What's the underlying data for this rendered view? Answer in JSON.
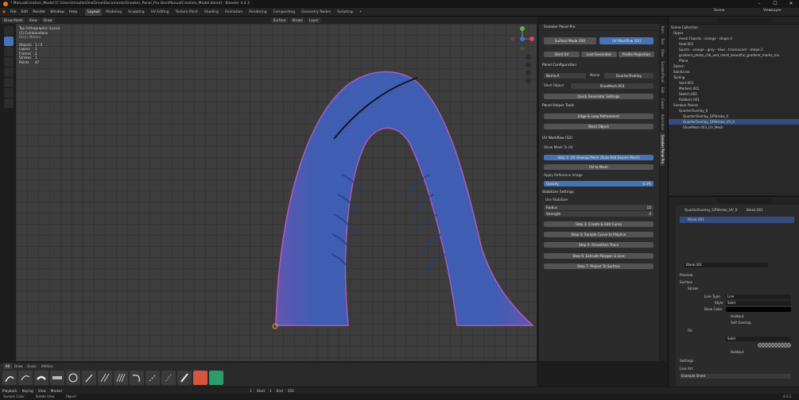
{
  "window": {
    "title": "* ManualCreation_Model [C:\\Users\\mouhk\\OneDrive\\Documents\\Sneaker_Panel_Pro Dev\\ManualCreation_Model.blend] - Blender 4.4.3",
    "min": "–",
    "max": "☐",
    "close": "✕"
  },
  "menu": [
    "File",
    "Edit",
    "Render",
    "Window",
    "Help"
  ],
  "workspaces": [
    "Layout",
    "Modeling",
    "Sculpting",
    "UV Editing",
    "Texture Paint",
    "Shading",
    "Animation",
    "Rendering",
    "Compositing",
    "Geometry Nodes",
    "Scripting",
    "+"
  ],
  "scene": {
    "label": "Scene",
    "viewlayer": "ViewLayer"
  },
  "viewport_header": {
    "mode": "Draw Mode",
    "view": "View",
    "draw": "Draw",
    "surface": "Surface",
    "layer": "Layer",
    "stroke": "Stroke"
  },
  "overlay": {
    "view_name": "Top Orthographic (Local)",
    "collection": "(1) Combinations",
    "sub": "Grid | Meters",
    "stats": [
      [
        "Objects",
        "1 / 5"
      ],
      [
        "Layers",
        "1"
      ],
      [
        "Frames",
        "2"
      ],
      [
        "Strokes",
        "1"
      ],
      [
        "Points",
        "47"
      ]
    ]
  },
  "npanel": {
    "title": "Sneaker Panel Pro",
    "surface_mode": "Surface Mode (S0)",
    "uv_workflow": "UV Workflow (S2)",
    "start_uv": "Start UV",
    "last_generator": "Last Generator",
    "profile_projection": "Profile Projection",
    "panel_config": "Panel Configuration",
    "field_a": "Name.A",
    "field_a_val": "4",
    "name_label": "Name",
    "name_val": "QuarterOverlay",
    "shell_obj_label": "Shell Object",
    "shell_obj": "ShoeMesh.003",
    "quick_generator": "Quick Generator Settings",
    "panel_helper": "Panel Helper Tools",
    "edge_loop": "Edge & Loop Refinement",
    "mesh_object": "Mesh Object",
    "uv_workflow_sec": "UV Workflow (S2)",
    "show_mesh": "Show Mesh To UV",
    "step1": "Step 1: UV Unwrap Mesh (Auto Add Seams Mesh)",
    "uv_mesh": "UV to Mesh",
    "apply_ref": "Apply Reference Image",
    "opacity": "Opacity",
    "opacity_val": "0.3%",
    "stab_settings": "Stabilizer Settings",
    "use_stab": "Use Stabilizer",
    "radius": "Radius",
    "radius_val": "15",
    "strength": "Strength",
    "strength_val": "0",
    "step3": "Step 3: Create & Edit Curve",
    "step4": "Step 4: Sample Curve to Polyline",
    "step5": "Step 5: Smoothen Trace",
    "step6": "Step 6: Extrude Polygon & Line",
    "step7": "Step 7: Project To Surface"
  },
  "vtabs": [
    "Item",
    "Tool",
    "View",
    "SneakerPanel",
    "Edit",
    "Create",
    "Animation",
    "Sneaker Panel Pro"
  ],
  "outliner": {
    "search": "",
    "items": [
      "Scene Collection",
      "Upper",
      "mesh.f.Sports - orange - shape.3",
      "Heel.001",
      "Sports - orange - gray - blue - translucent - shape.3",
      "gradient_photo_cilb_and_mesh_beautiful_gradient_marks_ma",
      "Plane",
      "Sketch",
      "SolidLines",
      "Tooling",
      "Vent.001",
      "Markers.001",
      "Sketch.002",
      "Rubbers.001",
      "Sneaker Panels",
      "QuarterOverlay_0",
      "QuarterOverlay_GPStroke_0",
      "QuarterOverlay_GPStroke_UV_0",
      "ShoeMesh.003_UV_Mesh"
    ]
  },
  "properties": {
    "object": "QuarterOverlay_GPStroke_UV_0",
    "data": "Blank.001",
    "material": "Blank.001",
    "material_field": "Blank.001",
    "preview": "Preview",
    "surface": "Surface",
    "stroke": "Stroke",
    "line_type_label": "Line Type",
    "line_type": "Line",
    "style_label": "Style",
    "style": "Solid",
    "base_color_label": "Base Color",
    "holdout": "Holdout",
    "self_overlap": "Self Overlap",
    "fill": "Fill",
    "fill_style": "Solid",
    "settings": "Settings",
    "viewport_display": "Viewport Display",
    "custom_props": "Custom Properties",
    "line_art": "Line Art",
    "example_sheet": "Example Sheet"
  },
  "shelf_tabs": [
    "All",
    "Draw",
    "Erase",
    "Utilities"
  ],
  "timeline": {
    "playback": "Playback",
    "keying": "Keying",
    "view": "View",
    "marker": "Marker",
    "start": "Start",
    "start_val": "1",
    "end": "End",
    "end_val": "250",
    "frame": "1"
  },
  "status": {
    "left": "Sample Color",
    "mid": "Rotate View",
    "right": "Object",
    "version": "4.4.3"
  },
  "colors": {
    "accent": "#4772b3",
    "mesh": "#3d5fae",
    "mesh_edge": "#b24fb9",
    "stroke": "#111111",
    "bg": "#3d3d3d"
  }
}
